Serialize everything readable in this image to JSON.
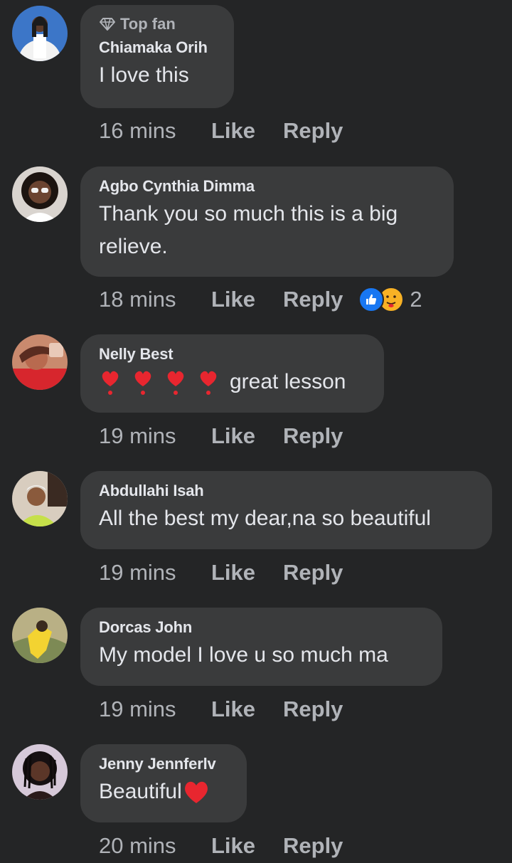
{
  "actions": {
    "like_label": "Like",
    "reply_label": "Reply"
  },
  "comments": [
    {
      "badge": "Top fan",
      "name": "Chiamaka Orih",
      "text": "I love this",
      "time": "16 mins"
    },
    {
      "name": "Agbo Cynthia Dimma",
      "text_line1": "Thank you so much this is a big",
      "text_line2": "relieve.",
      "time": "18 mins",
      "reaction_count": "2"
    },
    {
      "name": "Nelly Best",
      "text": "great lesson",
      "time": "19 mins"
    },
    {
      "name": "Abdullahi Isah",
      "text": "All the best my dear,na so beautiful",
      "time": "19 mins"
    },
    {
      "name": "Dorcas John",
      "text": "My model I love u so much ma",
      "time": "19 mins"
    },
    {
      "name": "Jenny Jennferlv",
      "text": "Beautiful",
      "time": "20 mins"
    }
  ],
  "icons": {
    "badge": "diamond-icon",
    "reaction_like": "thumbs-up-icon",
    "reaction_care": "care-emoji-icon",
    "emoji_heart": "heart-exclamation-icon",
    "emoji_red_heart": "red-heart-icon"
  },
  "colors": {
    "background": "#242526",
    "bubble": "#3a3b3c",
    "primary_text": "#e4e6eb",
    "secondary_text": "#b0b3b8",
    "like_blue": "#1877f2",
    "heart_red": "#e8262f"
  }
}
